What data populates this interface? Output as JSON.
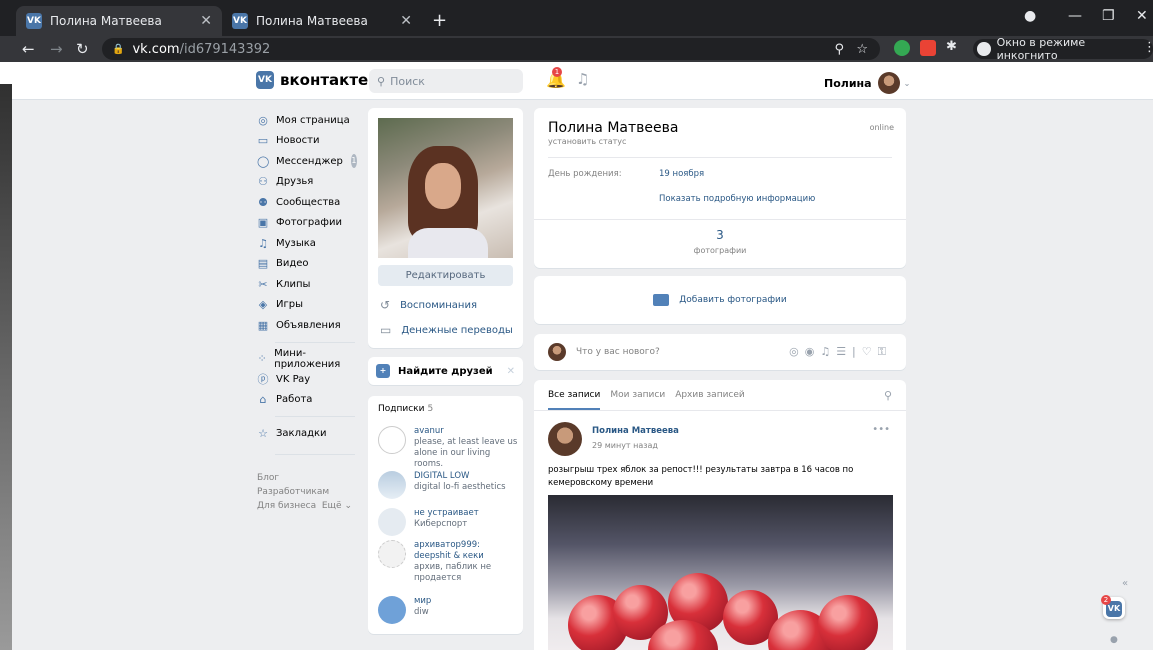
{
  "browser": {
    "tabs": [
      {
        "title": "Полина Матвеева"
      },
      {
        "title": "Полина Матвеева"
      }
    ],
    "url_domain": "vk.com",
    "url_path": "/id679143392",
    "incognito_label": "Окно в режиме инкогнито"
  },
  "header": {
    "logo_text": "вконтакте",
    "search_placeholder": "Поиск",
    "notifications_count": "1",
    "user_name": "Полина"
  },
  "sidebar": {
    "items": [
      {
        "label": "Моя страница",
        "icon": "user-circle-icon"
      },
      {
        "label": "Новости",
        "icon": "news-icon"
      },
      {
        "label": "Мессенджер",
        "icon": "messenger-icon",
        "count": "1"
      },
      {
        "label": "Друзья",
        "icon": "friends-icon"
      },
      {
        "label": "Сообщества",
        "icon": "communities-icon"
      },
      {
        "label": "Фотографии",
        "icon": "photos-icon"
      },
      {
        "label": "Музыка",
        "icon": "music-icon"
      },
      {
        "label": "Видео",
        "icon": "video-icon"
      },
      {
        "label": "Клипы",
        "icon": "clips-icon"
      },
      {
        "label": "Игры",
        "icon": "games-icon"
      },
      {
        "label": "Объявления",
        "icon": "ads-icon"
      }
    ],
    "items2": [
      {
        "label": "Мини-приложения",
        "icon": "mini-apps-icon"
      },
      {
        "label": "VK Pay",
        "icon": "vkpay-icon"
      },
      {
        "label": "Работа",
        "icon": "work-icon"
      }
    ],
    "bookmarks": "Закладки",
    "footer": [
      "Блог",
      "Разработчикам",
      "Для бизнеса",
      "Ещё"
    ]
  },
  "profile_card": {
    "edit_button": "Редактировать",
    "memories": "Воспоминания",
    "transfers": "Денежные переводы"
  },
  "find_friends": {
    "label": "Найдите друзей"
  },
  "subscriptions": {
    "title": "Подписки",
    "count": "5",
    "items": [
      {
        "name": "avanur",
        "desc": "please, at least leave us alone in our living rooms."
      },
      {
        "name": "DIGITAL LOW",
        "desc": "digital lo-fi aesthetics"
      },
      {
        "name": "не устраивает",
        "desc": "Киберспорт"
      },
      {
        "name": "архиватор999: deepshit & кеки",
        "desc": "архив, паблик не продается"
      },
      {
        "name": "мир",
        "desc": "diw"
      }
    ]
  },
  "profile": {
    "name": "Полина Матвеева",
    "status_link": "установить статус",
    "online": "online",
    "birthday_label": "День рождения:",
    "birthday_value": "19 ноября",
    "more_info": "Показать подробную информацию",
    "photos_count": "3",
    "photos_label": "фотографии"
  },
  "add_photos": {
    "label": "Добавить фотографии"
  },
  "new_post": {
    "placeholder": "Что у вас нового?"
  },
  "wall": {
    "tabs": [
      "Все записи",
      "Мои записи",
      "Архив записей"
    ],
    "post": {
      "author": "Полина Матвеева",
      "time": "29 минут назад",
      "text": "розыгрыш трех яблок за репост!!! результаты завтра в 16 часов по кемеровскому времени"
    }
  },
  "floating": {
    "vk_badge": "2"
  },
  "colors": {
    "accent": "#4a76a8",
    "link": "#2a5885",
    "bg": "#edeef0"
  }
}
